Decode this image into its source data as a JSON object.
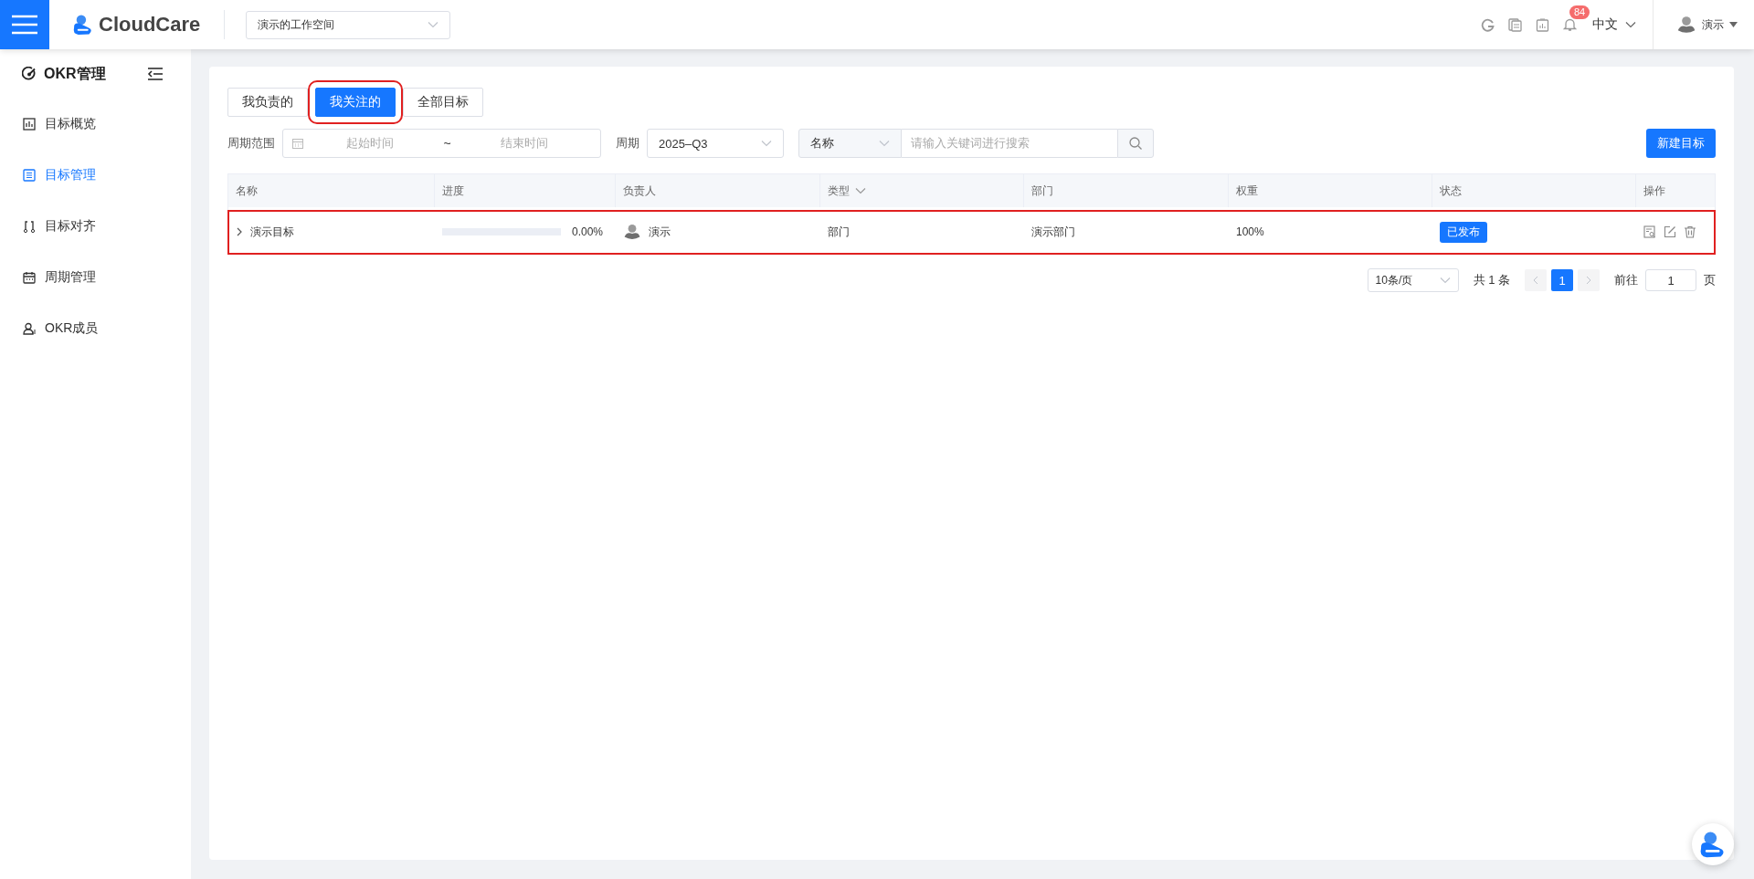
{
  "header": {
    "logo": "CloudCare",
    "workspace": "演示的工作空间",
    "notification_count": "84",
    "language": "中文",
    "user": "演示"
  },
  "sidebar": {
    "title": "OKR管理",
    "items": [
      {
        "label": "目标概览",
        "selected": false
      },
      {
        "label": "目标管理",
        "selected": true
      },
      {
        "label": "目标对齐",
        "selected": false
      },
      {
        "label": "周期管理",
        "selected": false
      },
      {
        "label": "OKR成员",
        "selected": false
      }
    ]
  },
  "tabs": [
    {
      "label": "我负责的",
      "selected": false,
      "highlighted": false
    },
    {
      "label": "我关注的",
      "selected": true,
      "highlighted": true
    },
    {
      "label": "全部目标",
      "selected": false,
      "highlighted": false
    }
  ],
  "filters": {
    "period_range_label": "周期范围",
    "start_placeholder": "起始时间",
    "range_separator": "~",
    "end_placeholder": "结束时间",
    "period_label": "周期",
    "period_value": "2025–Q3",
    "search_field": "名称",
    "search_placeholder": "请输入关键词进行搜索"
  },
  "new_button": "新建目标",
  "table": {
    "columns": [
      {
        "label": "名称",
        "filter": false
      },
      {
        "label": "进度",
        "filter": false
      },
      {
        "label": "负责人",
        "filter": false
      },
      {
        "label": "类型",
        "filter": true
      },
      {
        "label": "部门",
        "filter": false
      },
      {
        "label": "权重",
        "filter": false
      },
      {
        "label": "状态",
        "filter": false
      },
      {
        "label": "操作",
        "filter": false
      }
    ],
    "rows": [
      {
        "name": "演示目标",
        "expanded": false,
        "level": 0,
        "progress": "0.00%",
        "owner": "演示",
        "type": "部门",
        "department": "演示部门",
        "weight": "100%",
        "status": "已发布",
        "highlighted": true
      }
    ]
  },
  "pagination": {
    "page_size": "10条/页",
    "total": "共 1 条",
    "pages": [
      {
        "label": "1",
        "selected": true
      }
    ],
    "goto_label": "前往",
    "goto_value": "1",
    "page_suffix": "页"
  }
}
